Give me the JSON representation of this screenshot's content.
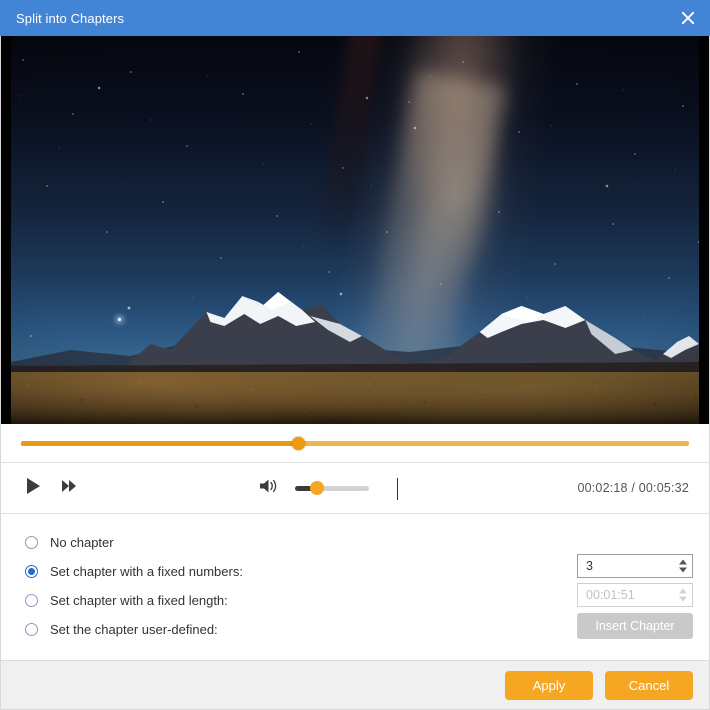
{
  "window": {
    "title": "Split into Chapters",
    "close_icon": "close-icon",
    "titlebar_color": "#4285d6"
  },
  "preview": {
    "description": "Night sky with Milky Way over snow-capped mountains and desert plain"
  },
  "progress": {
    "position_percent": 41.5,
    "track_color": "#eeb64b",
    "handle_color": "#ef9b0f"
  },
  "controls": {
    "play_icon": "play-icon",
    "forward_icon": "fast-forward-icon",
    "speaker_icon": "speaker-volume-icon",
    "volume_percent": 30,
    "volume_handle_color": "#f5a623",
    "current_time": "00:02:18",
    "total_time": "00:05:32",
    "time_display": "00:02:18 / 00:05:32"
  },
  "options": {
    "selected": 1,
    "items": [
      {
        "label": "No chapter",
        "checked": false
      },
      {
        "label": "Set chapter with a fixed numbers:",
        "checked": true
      },
      {
        "label": "Set chapter with a fixed length:",
        "checked": false
      },
      {
        "label": "Set the chapter user-defined:",
        "checked": false
      }
    ],
    "fixed_numbers": {
      "value": "3",
      "enabled": true
    },
    "fixed_length": {
      "value": "00:01:51",
      "placeholder": "00:01:51",
      "enabled": false
    },
    "insert_chapter_label": "Insert Chapter",
    "insert_chapter_enabled": false,
    "accent_color": "#1f6fc4"
  },
  "footer": {
    "apply_label": "Apply",
    "cancel_label": "Cancel",
    "button_color": "#f5a623"
  }
}
